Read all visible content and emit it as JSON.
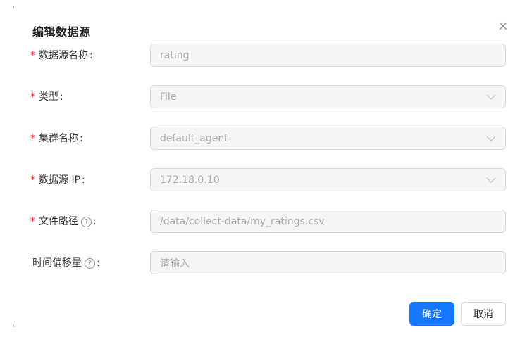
{
  "dialog": {
    "title": "编辑数据源",
    "close_icon": "close-icon"
  },
  "form": {
    "fields": [
      {
        "label": "数据源名称",
        "required": true,
        "help": false,
        "type": "input",
        "value": "rating"
      },
      {
        "label": "类型",
        "required": true,
        "help": false,
        "type": "select",
        "value": "File"
      },
      {
        "label": "集群名称",
        "required": true,
        "help": false,
        "type": "select",
        "value": "default_agent"
      },
      {
        "label": "数据源 IP",
        "required": true,
        "help": false,
        "type": "select",
        "value": "172.18.0.10"
      },
      {
        "label": "文件路径",
        "required": true,
        "help": true,
        "type": "input",
        "value": "/data/collect-data/my_ratings.csv"
      },
      {
        "label": "时间偏移量",
        "required": false,
        "help": true,
        "type": "input",
        "placeholder": "请输入"
      }
    ],
    "required_mark": "*",
    "colon": ":",
    "help_glyph": "?"
  },
  "footer": {
    "ok_label": "确定",
    "cancel_label": "取消"
  },
  "colors": {
    "primary": "#1677ff",
    "required": "#f5222d",
    "disabled_bg": "#f5f5f5"
  }
}
